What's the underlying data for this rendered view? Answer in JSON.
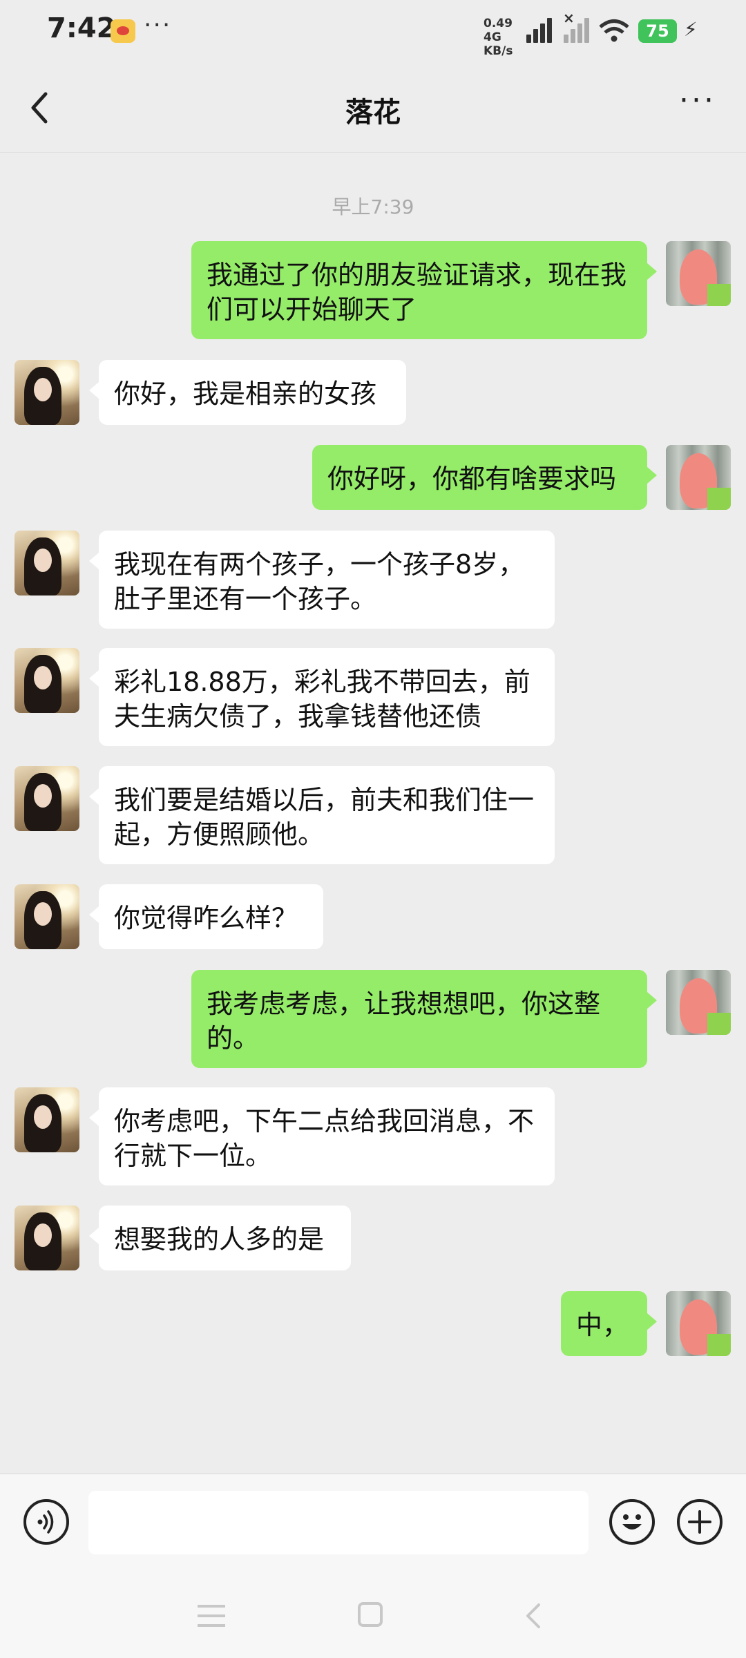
{
  "status_bar": {
    "time": "7:42",
    "dots": "···",
    "net_speed_value": "0.49",
    "net_type": "4G",
    "net_speed_unit": "KB/s",
    "battery": "75"
  },
  "header": {
    "title": "落花"
  },
  "chat": {
    "timestamp": "早上7:39",
    "messages": [
      {
        "side": "out",
        "text": "我通过了你的朋友验证请求，现在我们可以开始聊天了"
      },
      {
        "side": "in",
        "text": "你好，我是相亲的女孩"
      },
      {
        "side": "out",
        "text": "你好呀，你都有啥要求吗"
      },
      {
        "side": "in",
        "text": "我现在有两个孩子，一个孩子8岁，肚子里还有一个孩子。"
      },
      {
        "side": "in",
        "text": "彩礼18.88万，彩礼我不带回去，前夫生病欠债了，我拿钱替他还债"
      },
      {
        "side": "in",
        "text": "我们要是结婚以后，前夫和我们住一起，方便照顾他。"
      },
      {
        "side": "in",
        "text": "你觉得咋么样？"
      },
      {
        "side": "out",
        "text": "我考虑考虑，让我想想吧，你这整的。"
      },
      {
        "side": "in",
        "text": "你考虑吧，下午二点给我回消息，不行就下一位。"
      },
      {
        "side": "in",
        "text": "想娶我的人多的是"
      },
      {
        "side": "out",
        "text": "中，"
      }
    ]
  },
  "input": {
    "value": "",
    "placeholder": ""
  },
  "icons": {
    "back": "chevron-left-icon",
    "more": "more-horizontal-icon",
    "voice": "voice-icon",
    "emoji": "emoji-icon",
    "plus": "plus-icon"
  },
  "colors": {
    "outgoing_bubble": "#95ec69",
    "incoming_bubble": "#ffffff",
    "background": "#ededed",
    "battery": "#3fc35a"
  }
}
